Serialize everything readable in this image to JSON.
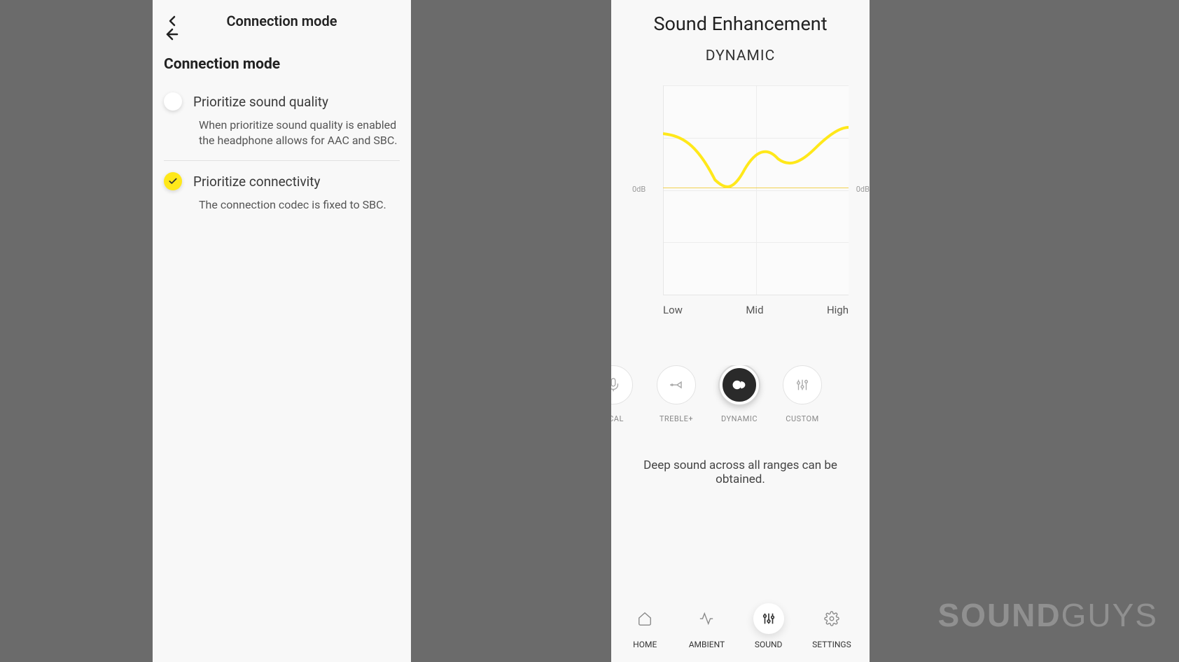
{
  "left": {
    "header_title": "Connection mode",
    "section_heading": "Connection mode",
    "options": [
      {
        "label": "Prioritize sound quality",
        "desc": "When prioritize sound quality is enabled the headphone allows for AAC and SBC.",
        "selected": false
      },
      {
        "label": "Prioritize connectivity",
        "desc": "The connection codec is fixed to SBC.",
        "selected": true
      }
    ]
  },
  "right": {
    "title": "Sound Enhancement",
    "active_preset": "DYNAMIC",
    "axis_left": "0dB",
    "axis_right": "0dB",
    "xaxis": {
      "low": "Low",
      "mid": "Mid",
      "high": "High"
    },
    "presets": [
      {
        "name": "OCAL",
        "icon": "mic-icon",
        "selected": false
      },
      {
        "name": "TREBLE+",
        "icon": "trumpet-icon",
        "selected": false
      },
      {
        "name": "DYNAMIC",
        "icon": "dynamic-icon",
        "selected": true
      },
      {
        "name": "CUSTOM",
        "icon": "sliders-icon",
        "selected": false
      }
    ],
    "description": "Deep sound across all ranges can be obtained.",
    "nav": [
      {
        "label": "HOME",
        "icon": "home-icon",
        "active": false
      },
      {
        "label": "AMBIENT",
        "icon": "ambient-icon",
        "active": false
      },
      {
        "label": "SOUND",
        "icon": "sound-icon",
        "active": true
      },
      {
        "label": "SETTINGS",
        "icon": "gear-icon",
        "active": false
      }
    ]
  },
  "chart_data": {
    "type": "line",
    "title": "Sound Enhancement",
    "xlabel": "",
    "ylabel": "",
    "x_ticks": [
      "Low",
      "Mid",
      "High"
    ],
    "ylim": [
      -12,
      12
    ],
    "zero_line_label": "0dB",
    "series": [
      {
        "name": "DYNAMIC",
        "color": "#ffe81a",
        "x": [
          0,
          0.25,
          0.4,
          0.55,
          0.7,
          0.85,
          1.0
        ],
        "values": [
          5,
          3,
          -2,
          2,
          1,
          3,
          6
        ]
      }
    ]
  },
  "watermark": {
    "bold": "SOUND",
    "light": "GUYS"
  }
}
